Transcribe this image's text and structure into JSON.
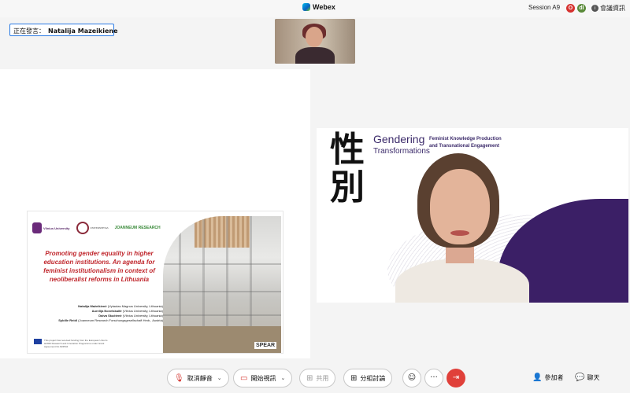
{
  "topbar": {
    "app_name": "Webex",
    "session": "Session A9",
    "avatar_o": "O",
    "avatar_d": "dl",
    "meeting_info": "會議資訊"
  },
  "speaker": {
    "prefix": "正在發言：",
    "name": "Natalija Mazeikiene"
  },
  "slide": {
    "logo_vu": "Vilnius University",
    "logo_ku": "UNIVERSITETAS",
    "logo_jr": "JOANNEUM RESEARCH",
    "title": "Promoting gender equality in higher education institutions. An agenda for feminist institutionalism in context of neoliberalist reforms in Lithuania",
    "authors": [
      {
        "name": "Natalija Mažeikienė",
        "affil": "(Vytautas Magnus University, Lithuania)"
      },
      {
        "name": "Aurelija Novelskaitė",
        "affil": "(Vilnius University, Lithuania)"
      },
      {
        "name": "Daiva Skučienė",
        "affil": "(Vilnius University, Lithuania)"
      },
      {
        "name": "Sybille Reidl",
        "affil": "(Joanneum Research Forschungsgesellschaft Hmb., Austria)"
      }
    ],
    "funding_note": "This project has received funding from the European Union's H2020 Research and Innovation Programme under Grant Agreement No 824544",
    "spear_logo": "SPEAR"
  },
  "video_bg": {
    "hanzi": "性別",
    "title_line1": "Gendering",
    "title_line2": "Transformations",
    "subtitle": "Feminist Knowledge Production and Transnational Engagement"
  },
  "controls": {
    "mute_label": "取消靜音",
    "video_label": "開始視訊",
    "share_label": "共用",
    "breakout_label": "分組討論",
    "more_label": "···",
    "participants_label": "參加者",
    "chat_label": "聊天"
  },
  "colors": {
    "accent": "#2b7be4",
    "leave": "#e0403a",
    "slide_title": "#c0272d",
    "brand_purple": "#3b1f66"
  }
}
